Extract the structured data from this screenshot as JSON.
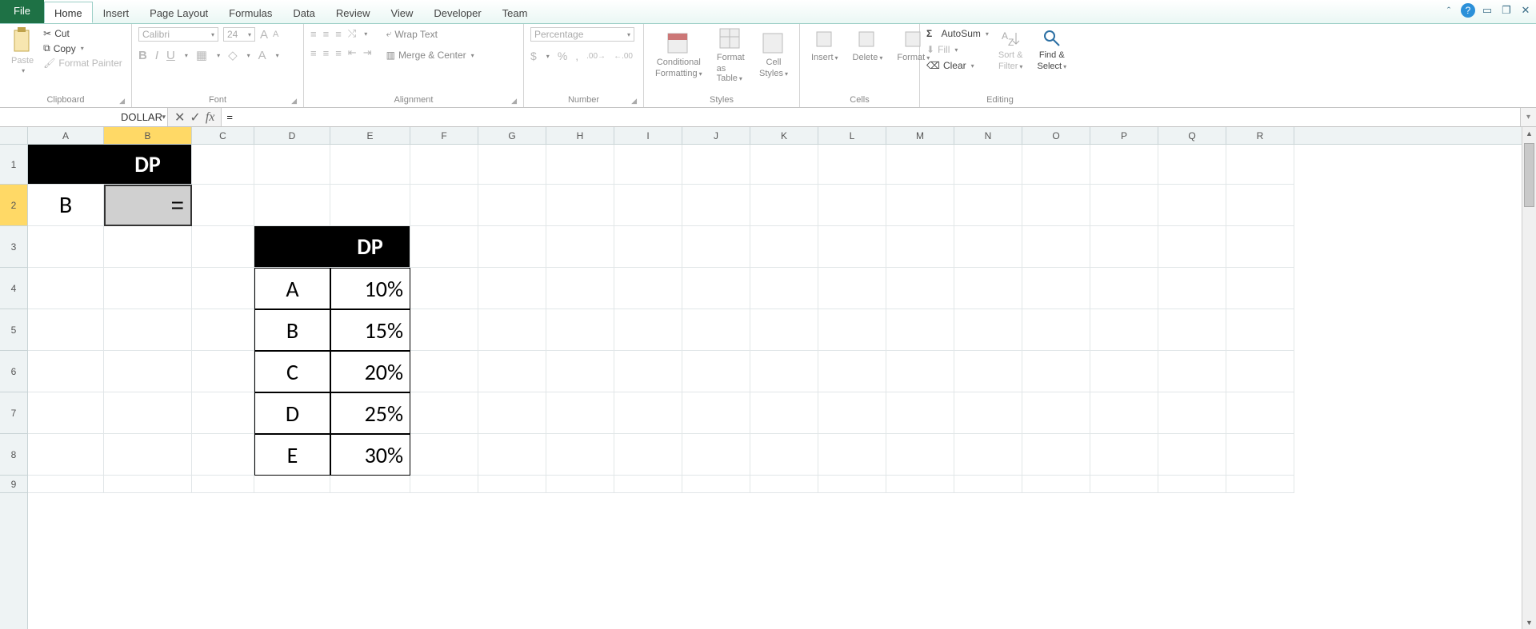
{
  "tabs": {
    "file": "File",
    "items": [
      "Home",
      "Insert",
      "Page Layout",
      "Formulas",
      "Data",
      "Review",
      "View",
      "Developer",
      "Team"
    ],
    "active": "Home"
  },
  "ribbon": {
    "clipboard": {
      "label": "Clipboard",
      "paste": "Paste",
      "cut": "Cut",
      "copy": "Copy",
      "format_painter": "Format Painter"
    },
    "font": {
      "label": "Font",
      "face": "Calibri",
      "size": "24"
    },
    "alignment": {
      "label": "Alignment",
      "wrap": "Wrap Text",
      "merge": "Merge & Center"
    },
    "number": {
      "label": "Number",
      "format": "Percentage"
    },
    "styles": {
      "label": "Styles",
      "cond": "Conditional",
      "cond2": "Formatting",
      "fat": "Format",
      "fat2": "as Table",
      "cs": "Cell",
      "cs2": "Styles"
    },
    "cells": {
      "label": "Cells",
      "insert": "Insert",
      "delete": "Delete",
      "format": "Format"
    },
    "editing": {
      "label": "Editing",
      "autosum": "AutoSum",
      "fill": "Fill",
      "clear": "Clear",
      "sort": "Sort &",
      "sort2": "Filter",
      "find": "Find &",
      "find2": "Select"
    }
  },
  "namebox": "DOLLAR",
  "formula": "=",
  "colheaders": [
    "A",
    "B",
    "C",
    "D",
    "E",
    "F",
    "G",
    "H",
    "I",
    "J",
    "K",
    "L",
    "M",
    "N",
    "O",
    "P",
    "Q",
    "R"
  ],
  "rowheaders": [
    "1",
    "2",
    "3",
    "4",
    "5",
    "6",
    "7",
    "8",
    "9"
  ],
  "sheet": {
    "b1": "DP",
    "a2": "B",
    "b2": "=",
    "e3": "DP",
    "table": [
      {
        "key": "A",
        "val": "10%"
      },
      {
        "key": "B",
        "val": "15%"
      },
      {
        "key": "C",
        "val": "20%"
      },
      {
        "key": "D",
        "val": "25%"
      },
      {
        "key": "E",
        "val": "30%"
      }
    ]
  }
}
